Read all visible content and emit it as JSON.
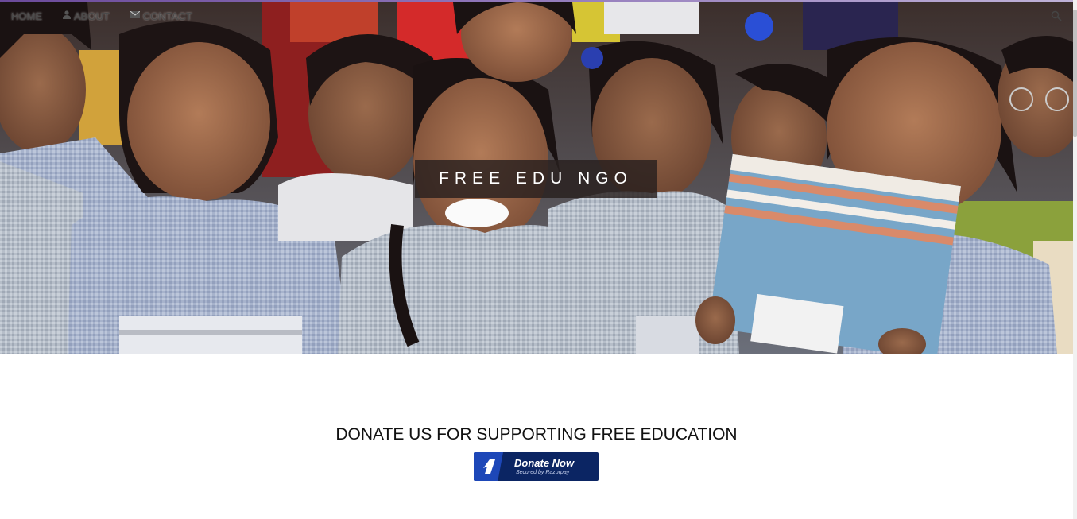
{
  "nav": {
    "items": [
      {
        "label": "HOME",
        "icon": "home-icon"
      },
      {
        "label": "ABOUT",
        "icon": "user-icon"
      },
      {
        "label": "CONTACT",
        "icon": "envelope-icon"
      }
    ],
    "search_icon": "search-icon"
  },
  "hero": {
    "title": "FREE EDU NGO",
    "image_description": "group of smiling schoolgirls in checked uniforms holding notebooks"
  },
  "donate": {
    "heading": "DONATE US FOR SUPPORTING FREE EDUCATION",
    "button_label": "Donate Now",
    "button_sub": "Secured by Razorpay",
    "button_color": "#0b2563",
    "logo_color": "#1d47b8"
  }
}
